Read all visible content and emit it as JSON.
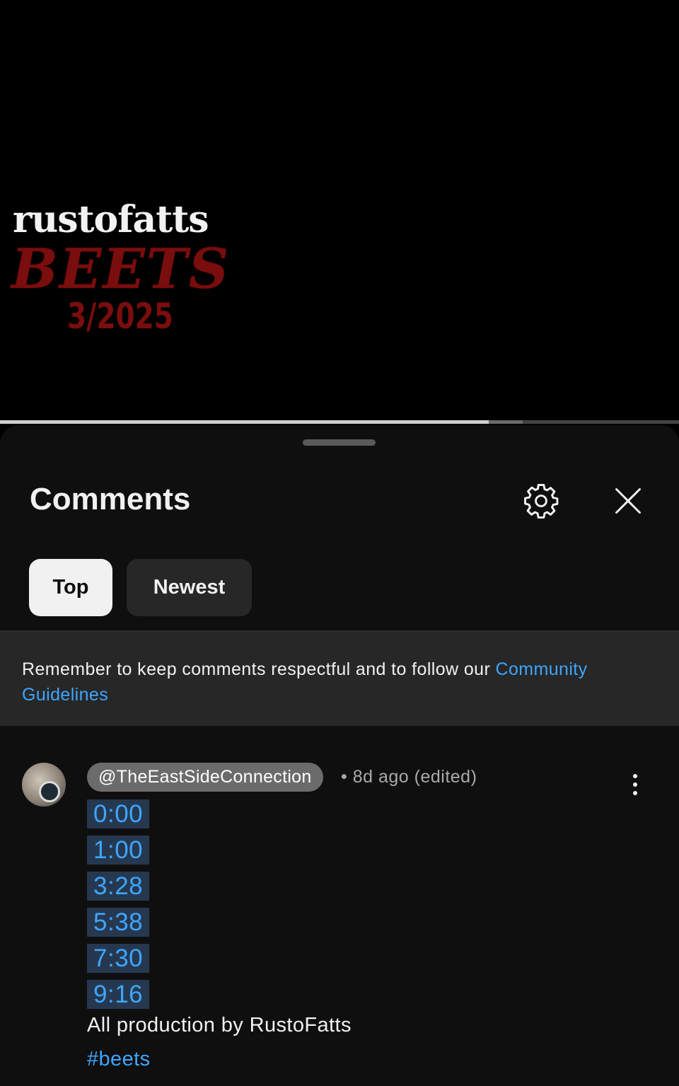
{
  "video": {
    "overlay_line1": "rustofatts",
    "overlay_line2": "BEETS",
    "overlay_line3": "3/2025",
    "progress_played": 0.72,
    "progress_buffered": 0.77
  },
  "sheet": {
    "title": "Comments",
    "settings_icon": "gear-icon",
    "close_icon": "close-icon"
  },
  "filters": {
    "top": "Top",
    "newest": "Newest",
    "selected": "Top"
  },
  "notice": {
    "text": "Remember to keep comments respectful and to follow our ",
    "link": "Community Guidelines"
  },
  "comment": {
    "author": "@TheEastSideConnection",
    "separator": "•",
    "age": "8d ago (edited)",
    "timestamps": [
      "0:00",
      "1:00",
      "3:28",
      "5:38",
      "7:30",
      "9:16"
    ],
    "body": "All production by RustoFatts",
    "hashtag": "#beets"
  },
  "colors": {
    "background": "#0f0f0f",
    "link": "#3ea6ff",
    "timestamp_bg": "#263850",
    "chip_selected_bg": "#f1f1f1",
    "chip_bg": "#272727",
    "logo_red": "#7a0d0d"
  }
}
